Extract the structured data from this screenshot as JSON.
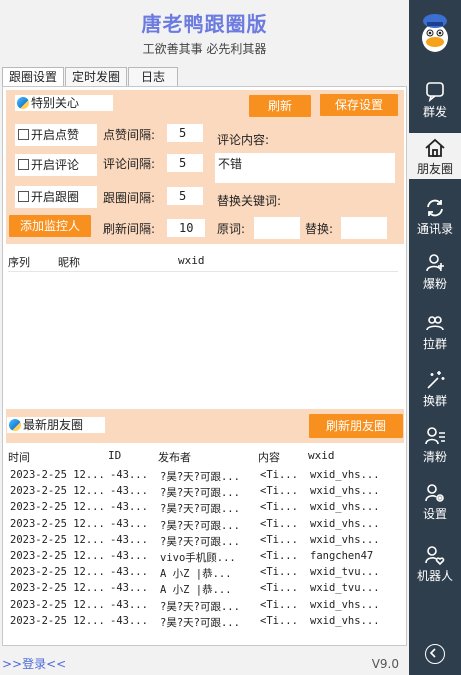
{
  "app": {
    "title": "唐老鸭跟圈版",
    "subtitle": "工欲善其事  必先利其器",
    "version": "V9.0",
    "login_link": ">>登录<<"
  },
  "tabs": [
    {
      "label": "跟圈设置",
      "active": true
    },
    {
      "label": "定时发圈",
      "active": false
    },
    {
      "label": "日志",
      "active": false
    }
  ],
  "special": {
    "header": "特别关心",
    "refresh_btn": "刷新",
    "save_btn": "保存设置",
    "like_check": "开启点赞",
    "comment_check": "开启评论",
    "follow_check": "开启跟圈",
    "add_btn": "添加监控人",
    "like_interval_label": "点赞间隔:",
    "like_interval": "5",
    "comment_interval_label": "评论间隔:",
    "comment_interval": "5",
    "follow_interval_label": "跟圈间隔:",
    "follow_interval": "5",
    "refresh_interval_label": "刷新间隔:",
    "refresh_interval": "10",
    "comment_content_label": "评论内容:",
    "comment_content": "不错",
    "replace_label": "替换关键词:",
    "orig_label": "原词:",
    "orig_value": "",
    "replace_with_label": "替换:",
    "replace_with_value": ""
  },
  "monitor_table": {
    "columns": [
      "序列",
      "昵称",
      "wxid"
    ]
  },
  "moments": {
    "header": "最新朋友圈",
    "refresh_btn": "刷新朋友圈",
    "columns": [
      "时间",
      "ID",
      "发布者",
      "内容",
      "wxid"
    ],
    "rows": [
      [
        "2023-2-25 12...",
        "-43...",
        "?昊?天?可跟...",
        "<Ti...",
        "wxid_vhs..."
      ],
      [
        "2023-2-25 12...",
        "-43...",
        "?昊?天?可跟...",
        "<Ti...",
        "wxid_vhs..."
      ],
      [
        "2023-2-25 12...",
        "-43...",
        "?昊?天?可跟...",
        "<Ti...",
        "wxid_vhs..."
      ],
      [
        "2023-2-25 12...",
        "-43...",
        "?昊?天?可跟...",
        "<Ti...",
        "wxid_vhs..."
      ],
      [
        "2023-2-25 12...",
        "-43...",
        "?昊?天?可跟...",
        "<Ti...",
        "wxid_vhs..."
      ],
      [
        "2023-2-25 12...",
        "-43...",
        "vivo手机顾...",
        "<Ti...",
        "fangchen47"
      ],
      [
        "2023-2-25 12...",
        "-43...",
        "A 小Z   |恭...",
        "<Ti...",
        "wxid_tvu..."
      ],
      [
        "2023-2-25 12...",
        "-43...",
        "A 小Z   |恭...",
        "<Ti...",
        "wxid_tvu..."
      ],
      [
        "2023-2-25 12...",
        "-43...",
        "?昊?天?可跟...",
        "<Ti...",
        "wxid_vhs..."
      ],
      [
        "2023-2-25 12...",
        "-43...",
        "?昊?天?可跟...",
        "<Ti...",
        "wxid_vhs..."
      ]
    ]
  },
  "sidebar": {
    "items": [
      {
        "label": "群发",
        "icon": "chat-icon",
        "active": false
      },
      {
        "label": "朋友圈",
        "icon": "home-icon",
        "active": true
      },
      {
        "label": "通讯录",
        "icon": "sync-icon",
        "active": false
      },
      {
        "label": "爆粉",
        "icon": "add-user-icon",
        "active": false
      },
      {
        "label": "拉群",
        "icon": "group-icon",
        "active": false
      },
      {
        "label": "换群",
        "icon": "magic-wand-icon",
        "active": false
      },
      {
        "label": "清粉",
        "icon": "user-list-icon",
        "active": false
      },
      {
        "label": "设置",
        "icon": "user-settings-icon",
        "active": false
      },
      {
        "label": "机器人",
        "icon": "user-heart-icon",
        "active": false
      }
    ]
  },
  "colors": {
    "accent": "#f7901e",
    "panel": "#fbd9bf",
    "sidebar": "#2f3e4c",
    "title": "#6b7be0"
  }
}
